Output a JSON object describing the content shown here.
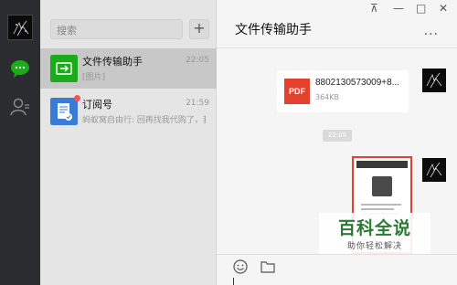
{
  "sidebar": {
    "search_placeholder": "搜索",
    "add_label": "+"
  },
  "chats": [
    {
      "name": "文件传输助手",
      "time": "22:05",
      "preview": "[图片]",
      "active": true,
      "avatar_icon": "file-transfer-icon",
      "avatar_color": "#1aad19"
    },
    {
      "name": "订阅号",
      "time": "21:59",
      "preview": "蚂蚁窝自由行: 回再找我代购了，我们真的...",
      "active": false,
      "avatar_icon": "subscription-icon",
      "avatar_color": "#3a7bd5",
      "unread_dot": true
    }
  ],
  "conversation": {
    "title": "文件传输助手",
    "more_label": "...",
    "file": {
      "name": "8802130573009+8...",
      "size": "364KB",
      "type_label": "PDF"
    },
    "time_divider": "22:05"
  },
  "window_controls": {
    "pin": "⊼",
    "minimize": "—",
    "maximize": "□",
    "close": "✕"
  },
  "watermark": {
    "title": "百科全说",
    "subtitle": "助你轻松解决"
  },
  "colors": {
    "accent_green": "#1aad19",
    "highlight_red": "#e53f2d",
    "rail": "#2b2c2f"
  }
}
